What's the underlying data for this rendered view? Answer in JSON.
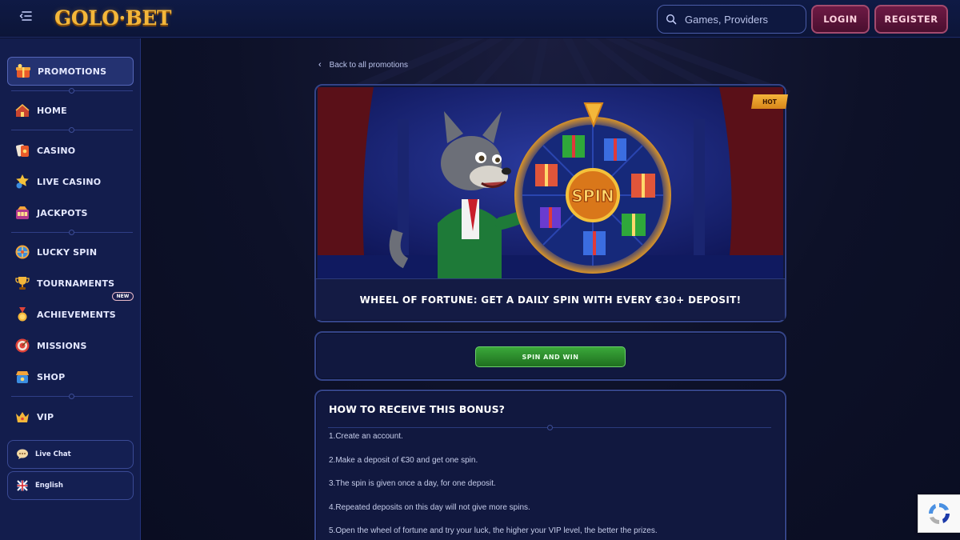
{
  "header": {
    "logo_text": "GOLO·BET",
    "search": {
      "placeholder": "Games, Providers"
    },
    "login_label": "LOGIN",
    "register_label": "REGISTER"
  },
  "sidebar": {
    "items": [
      {
        "label": "PROMOTIONS",
        "icon": "promotions-icon",
        "active": true
      },
      {
        "label": "HOME",
        "icon": "home-icon"
      },
      {
        "label": "CASINO",
        "icon": "casino-icon"
      },
      {
        "label": "LIVE CASINO",
        "icon": "live-casino-icon"
      },
      {
        "label": "JACKPOTS",
        "icon": "jackpots-icon"
      },
      {
        "label": "LUCKY SPIN",
        "icon": "lucky-spin-icon"
      },
      {
        "label": "TOURNAMENTS",
        "icon": "trophy-icon"
      },
      {
        "label": "ACHIEVEMENTS",
        "icon": "medal-icon"
      },
      {
        "label": "MISSIONS",
        "icon": "target-icon",
        "badge": "NEW"
      },
      {
        "label": "SHOP",
        "icon": "shop-icon"
      },
      {
        "label": "VIP",
        "icon": "crown-icon"
      }
    ],
    "live_chat_label": "Live Chat",
    "language_label": "English"
  },
  "promo": {
    "back_label": "Back to all promotions",
    "hot_tag": "HOT",
    "wheel_center": "SPIN",
    "title": "WHEEL OF FORTUNE: GET A DAILY SPIN WITH EVERY €30+ DEPOSIT!",
    "cta_label": "SPIN AND WIN",
    "info_title": "HOW TO RECEIVE THIS BONUS?",
    "steps": [
      "1.Create an account.",
      "2.Make a deposit of €30 and get one spin.",
      "3.The spin is given once a day, for one deposit.",
      "4.Repeated deposits on this day will not give more spins.",
      "5.Open the wheel of fortune and try your luck, the higher your VIP level, the better the prizes."
    ]
  },
  "colors": {
    "accent_gold": "#f4b73a",
    "button_maroon": "#6e1a45",
    "cta_green": "#3aa83a",
    "panel_navy": "#131d4d"
  }
}
